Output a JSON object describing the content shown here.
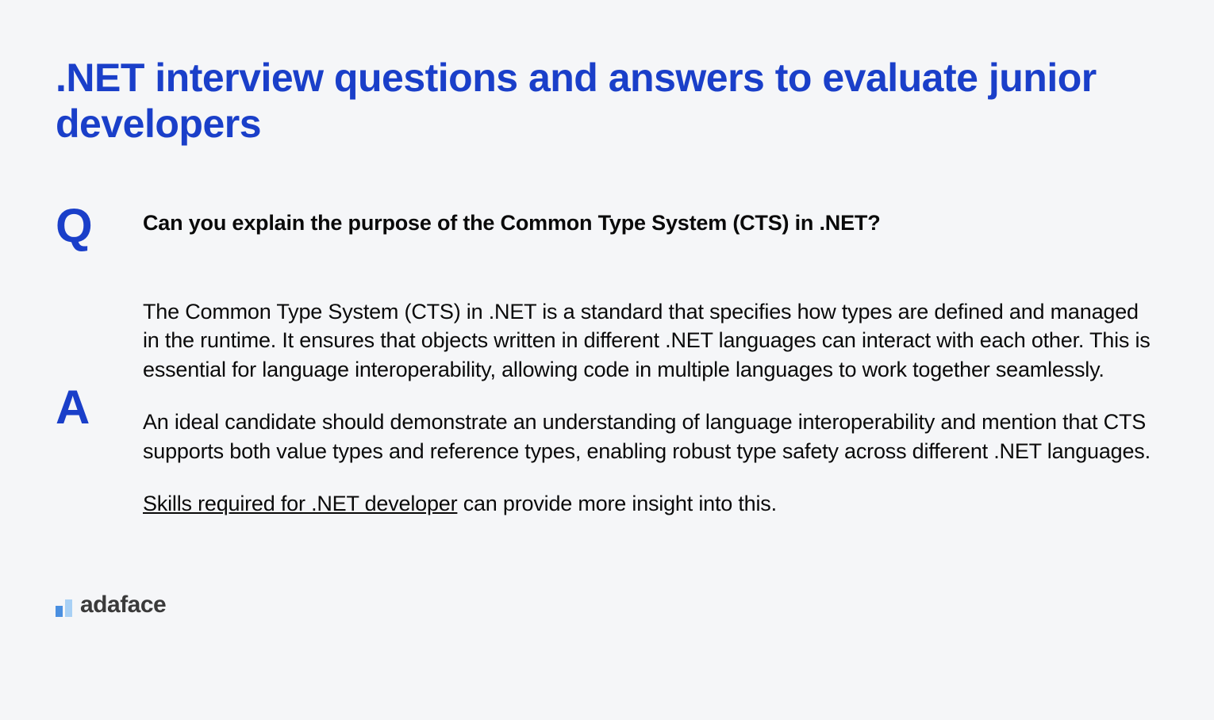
{
  "title": ".NET interview questions and answers to evaluate junior developers",
  "question": {
    "label": "Q",
    "text": "Can you explain the purpose of the Common Type System (CTS) in .NET?"
  },
  "answer": {
    "label": "A",
    "para1": "The Common Type System (CTS) in .NET is a standard that specifies how types are defined and managed in the runtime. It ensures that objects written in different .NET languages can interact with each other. This is essential for language interoperability, allowing code in multiple languages to work together seamlessly.",
    "para2": "An ideal candidate should demonstrate an understanding of language interoperability and mention that CTS supports both value types and reference types, enabling robust type safety across different .NET languages.",
    "link_text": "Skills required for .NET developer",
    "link_suffix": " can provide more insight into this."
  },
  "brand": "adaface"
}
